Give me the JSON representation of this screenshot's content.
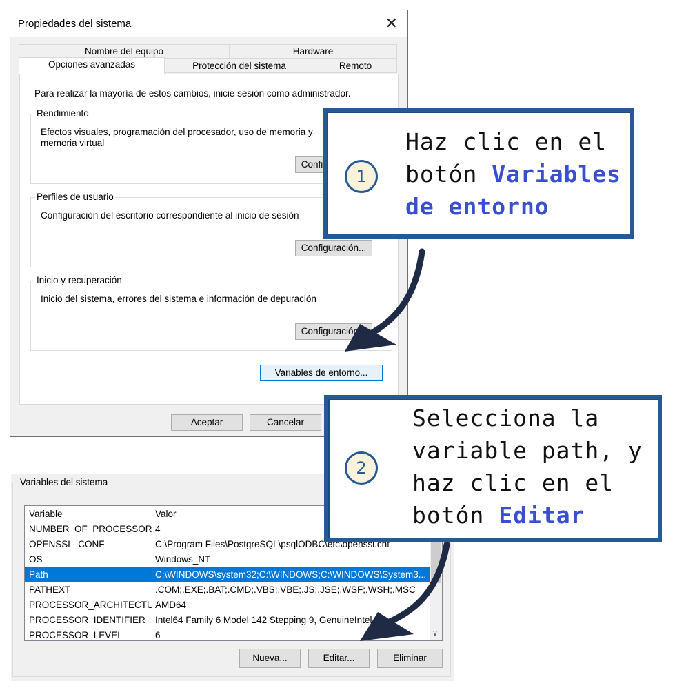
{
  "dialog": {
    "title": "Propiedades del sistema",
    "close_glyph": "✕",
    "tabs_back": [
      "Nombre del equipo",
      "Hardware"
    ],
    "tabs_front": [
      "Opciones avanzadas",
      "Protección del sistema",
      "Remoto"
    ],
    "intro": "Para realizar la mayoría de estos cambios, inicie sesión como administrador.",
    "groups": [
      {
        "legend": "Rendimiento",
        "desc": "Efectos visuales, programación del procesador, uso de memoria y memoria virtual",
        "button": "Configuración..."
      },
      {
        "legend": "Perfiles de usuario",
        "desc": "Configuración del escritorio correspondiente al inicio de sesión",
        "button": "Configuración..."
      },
      {
        "legend": "Inicio y recuperación",
        "desc": "Inicio del sistema, errores del sistema e información de depuración",
        "button": "Configuración..."
      }
    ],
    "env_button": "Variables de entorno...",
    "ok_button": "Aceptar",
    "cancel_button": "Cancelar"
  },
  "system_vars": {
    "legend": "Variables del sistema",
    "headers": [
      "Variable",
      "Valor"
    ],
    "rows": [
      [
        "NUMBER_OF_PROCESSORS",
        "4"
      ],
      [
        "OPENSSL_CONF",
        "C:\\Program Files\\PostgreSQL\\psqlODBC\\etc\\openssl.cnf"
      ],
      [
        "OS",
        "Windows_NT"
      ],
      [
        "Path",
        "C:\\WINDOWS\\system32;C:\\WINDOWS;C:\\WINDOWS\\System3..."
      ],
      [
        "PATHEXT",
        ".COM;.EXE;.BAT;.CMD;.VBS;.VBE;.JS;.JSE;.WSF;.WSH;.MSC"
      ],
      [
        "PROCESSOR_ARCHITECTU...",
        "AMD64"
      ],
      [
        "PROCESSOR_IDENTIFIER",
        "Intel64 Family 6 Model 142 Stepping 9, GenuineIntel"
      ],
      [
        "PROCESSOR_LEVEL",
        "6"
      ]
    ],
    "selected_index": 3,
    "new_button": "Nueva...",
    "edit_button": "Editar...",
    "delete_button": "Eliminar"
  },
  "callouts": [
    {
      "number": "1",
      "text_plain": "Haz clic en el botón ",
      "text_highlight": "Variables de entorno"
    },
    {
      "number": "2",
      "text_plain": "Selecciona la variable path, y haz clic en el botón ",
      "text_highlight": "Editar"
    }
  ],
  "colors": {
    "accent": "#265a94",
    "highlight": "#3a4fd0",
    "selection": "#0078d7",
    "arrow": "#1f2b44"
  }
}
